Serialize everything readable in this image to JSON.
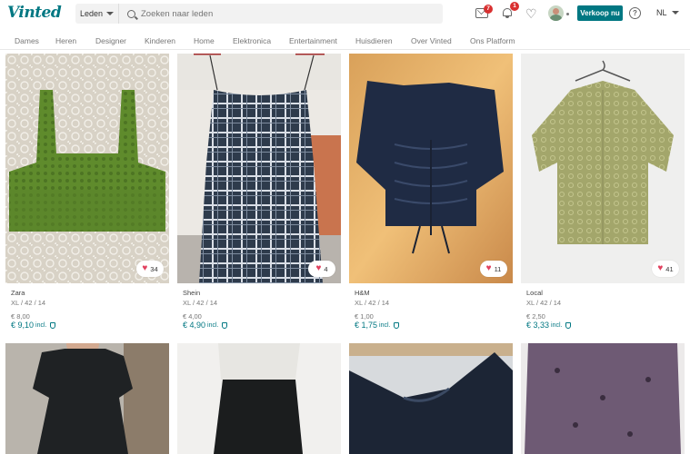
{
  "header": {
    "logo": "Vinted",
    "search_category": "Leden",
    "search_placeholder": "Zoeken naar leden",
    "messages_count": "7",
    "notifications_count": "1",
    "sell_label": "Verkoop nu",
    "help_glyph": "?",
    "language": "NL"
  },
  "nav": {
    "items": [
      "Dames",
      "Heren",
      "Designer",
      "Kinderen",
      "Home",
      "Elektronica",
      "Entertainment",
      "Huisdieren",
      "Over Vinted",
      "Ons Platform"
    ]
  },
  "items": [
    {
      "brand": "Zara",
      "size": "XL / 42 / 14",
      "price": "€ 8,00",
      "price_incl": "€ 9,10",
      "incl_label": "incl.",
      "likes": "34",
      "color": "#5d8a2e"
    },
    {
      "brand": "Shein",
      "size": "XL / 42 / 14",
      "price": "€ 4,00",
      "price_incl": "€ 4,90",
      "incl_label": "incl.",
      "likes": "4",
      "color": "#2d3a48"
    },
    {
      "brand": "H&M",
      "size": "XL / 42 / 14",
      "price": "€ 1,00",
      "price_incl": "€ 1,75",
      "incl_label": "incl.",
      "likes": "11",
      "color": "#1f2b44"
    },
    {
      "brand": "Local",
      "size": "XL / 42 / 14",
      "price": "€ 2,50",
      "price_incl": "€ 3,33",
      "incl_label": "incl.",
      "likes": "41",
      "color": "#9ea069"
    }
  ],
  "icons": {
    "heart": "♥",
    "heart_outline": "♡"
  },
  "colors": {
    "brand": "#007782",
    "badge": "#d93030",
    "like": "#e1415f"
  }
}
